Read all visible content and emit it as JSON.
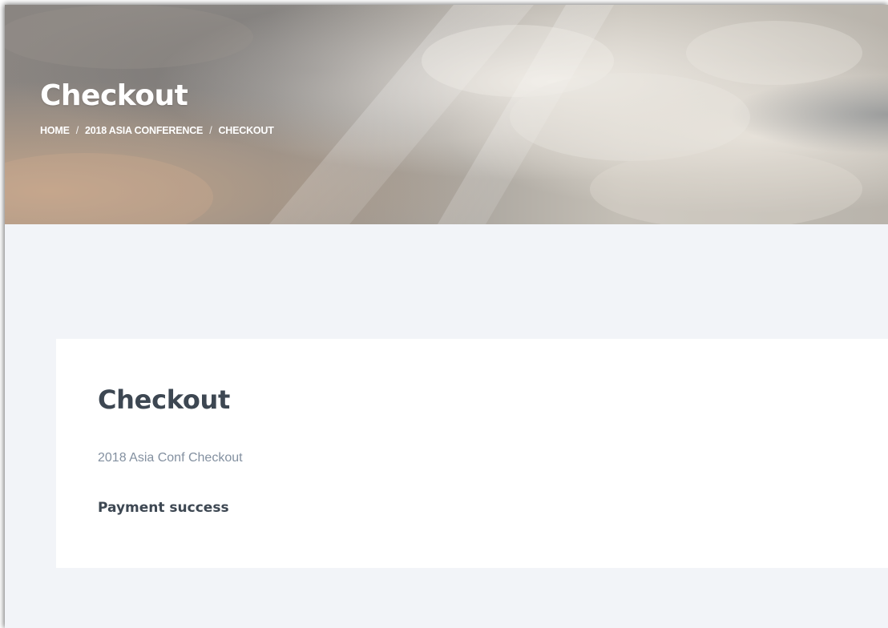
{
  "header": {
    "title": "Checkout",
    "breadcrumb": {
      "home": "HOME",
      "event": "2018 ASIA CONFERENCE",
      "current": "CHECKOUT",
      "separator": "/"
    }
  },
  "main": {
    "title": "Checkout",
    "subtitle": "2018 Asia Conf Checkout",
    "status": "Payment success"
  }
}
